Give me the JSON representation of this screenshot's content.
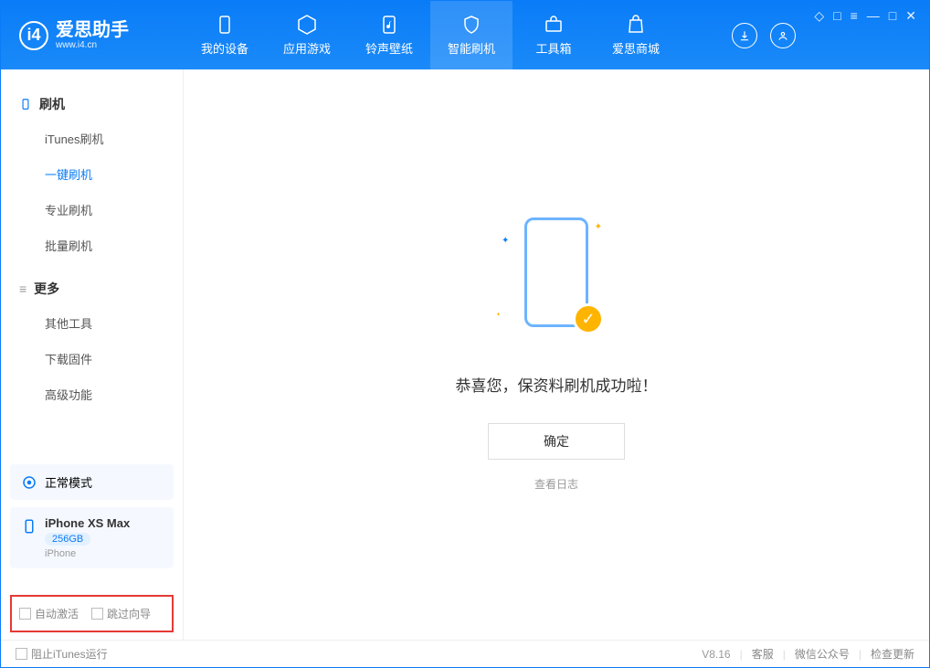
{
  "app": {
    "name": "爱思助手",
    "url": "www.i4.cn"
  },
  "nav": {
    "items": [
      {
        "label": "我的设备"
      },
      {
        "label": "应用游戏"
      },
      {
        "label": "铃声壁纸"
      },
      {
        "label": "智能刷机"
      },
      {
        "label": "工具箱"
      },
      {
        "label": "爱思商城"
      }
    ]
  },
  "sidebar": {
    "section1": {
      "title": "刷机",
      "items": [
        "iTunes刷机",
        "一键刷机",
        "专业刷机",
        "批量刷机"
      ]
    },
    "section2": {
      "title": "更多",
      "items": [
        "其他工具",
        "下载固件",
        "高级功能"
      ]
    },
    "mode": "正常模式",
    "device": {
      "name": "iPhone XS Max",
      "storage": "256GB",
      "type": "iPhone"
    },
    "checks": {
      "auto_activate": "自动激活",
      "skip_guide": "跳过向导"
    }
  },
  "main": {
    "message": "恭喜您，保资料刷机成功啦！",
    "ok": "确定",
    "log_link": "查看日志"
  },
  "status": {
    "block_itunes": "阻止iTunes运行",
    "version": "V8.16",
    "links": [
      "客服",
      "微信公众号",
      "检查更新"
    ]
  }
}
